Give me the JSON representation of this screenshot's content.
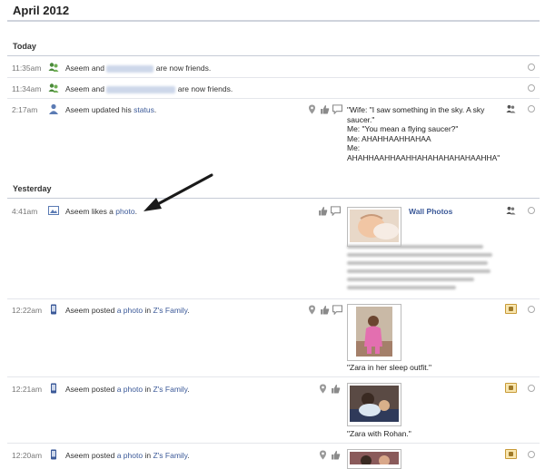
{
  "month": {
    "title": "April 2012"
  },
  "sections": {
    "today": {
      "label": "Today"
    },
    "yesterday": {
      "label": "Yesterday"
    }
  },
  "today_rows": [
    {
      "time": "11:35am",
      "prefix": "Aseem and",
      "suffix": "are now friends."
    },
    {
      "time": "11:34am",
      "prefix": "Aseem and",
      "suffix": "are now friends."
    },
    {
      "time": "2:17am",
      "prefix": "Aseem updated his",
      "link": "status",
      "end": ".",
      "quote": "\"Wife: \"I saw something in the sky. A sky saucer.\"\nMe: \"You mean a flying saucer?\"\nMe: AHAHHAAHHAHAA\nMe:\nAHAHHAAHHAAHHAHAHAHAHAHAAHHA\""
    }
  ],
  "yesterday_rows": [
    {
      "time": "4:41am",
      "prefix": "Aseem likes a",
      "link": "photo",
      "end": ".",
      "album": "Wall Photos"
    },
    {
      "time": "12:22am",
      "prefix": "Aseem posted",
      "link": "a photo",
      "mid": "in",
      "group": "Z's Family",
      "end": ".",
      "caption": "\"Zara in her sleep outfit.\""
    },
    {
      "time": "12:21am",
      "prefix": "Aseem posted",
      "link": "a photo",
      "mid": "in",
      "group": "Z's Family",
      "end": ".",
      "caption": "\"Zara with Rohan.\""
    },
    {
      "time": "12:20am",
      "prefix": "Aseem posted",
      "link": "a photo",
      "mid": "in",
      "group": "Z's Family",
      "end": "."
    }
  ],
  "colors": {
    "link": "#3b5998",
    "rule": "#c6cbd6",
    "arrow": "#1a1a1a"
  },
  "icons": [
    "friends-icon",
    "profile-icon",
    "photo-like-icon",
    "mobile-icon",
    "location-icon",
    "like-icon",
    "comment-icon",
    "audience-friends-icon",
    "family-audience-icon",
    "hide-radio"
  ]
}
